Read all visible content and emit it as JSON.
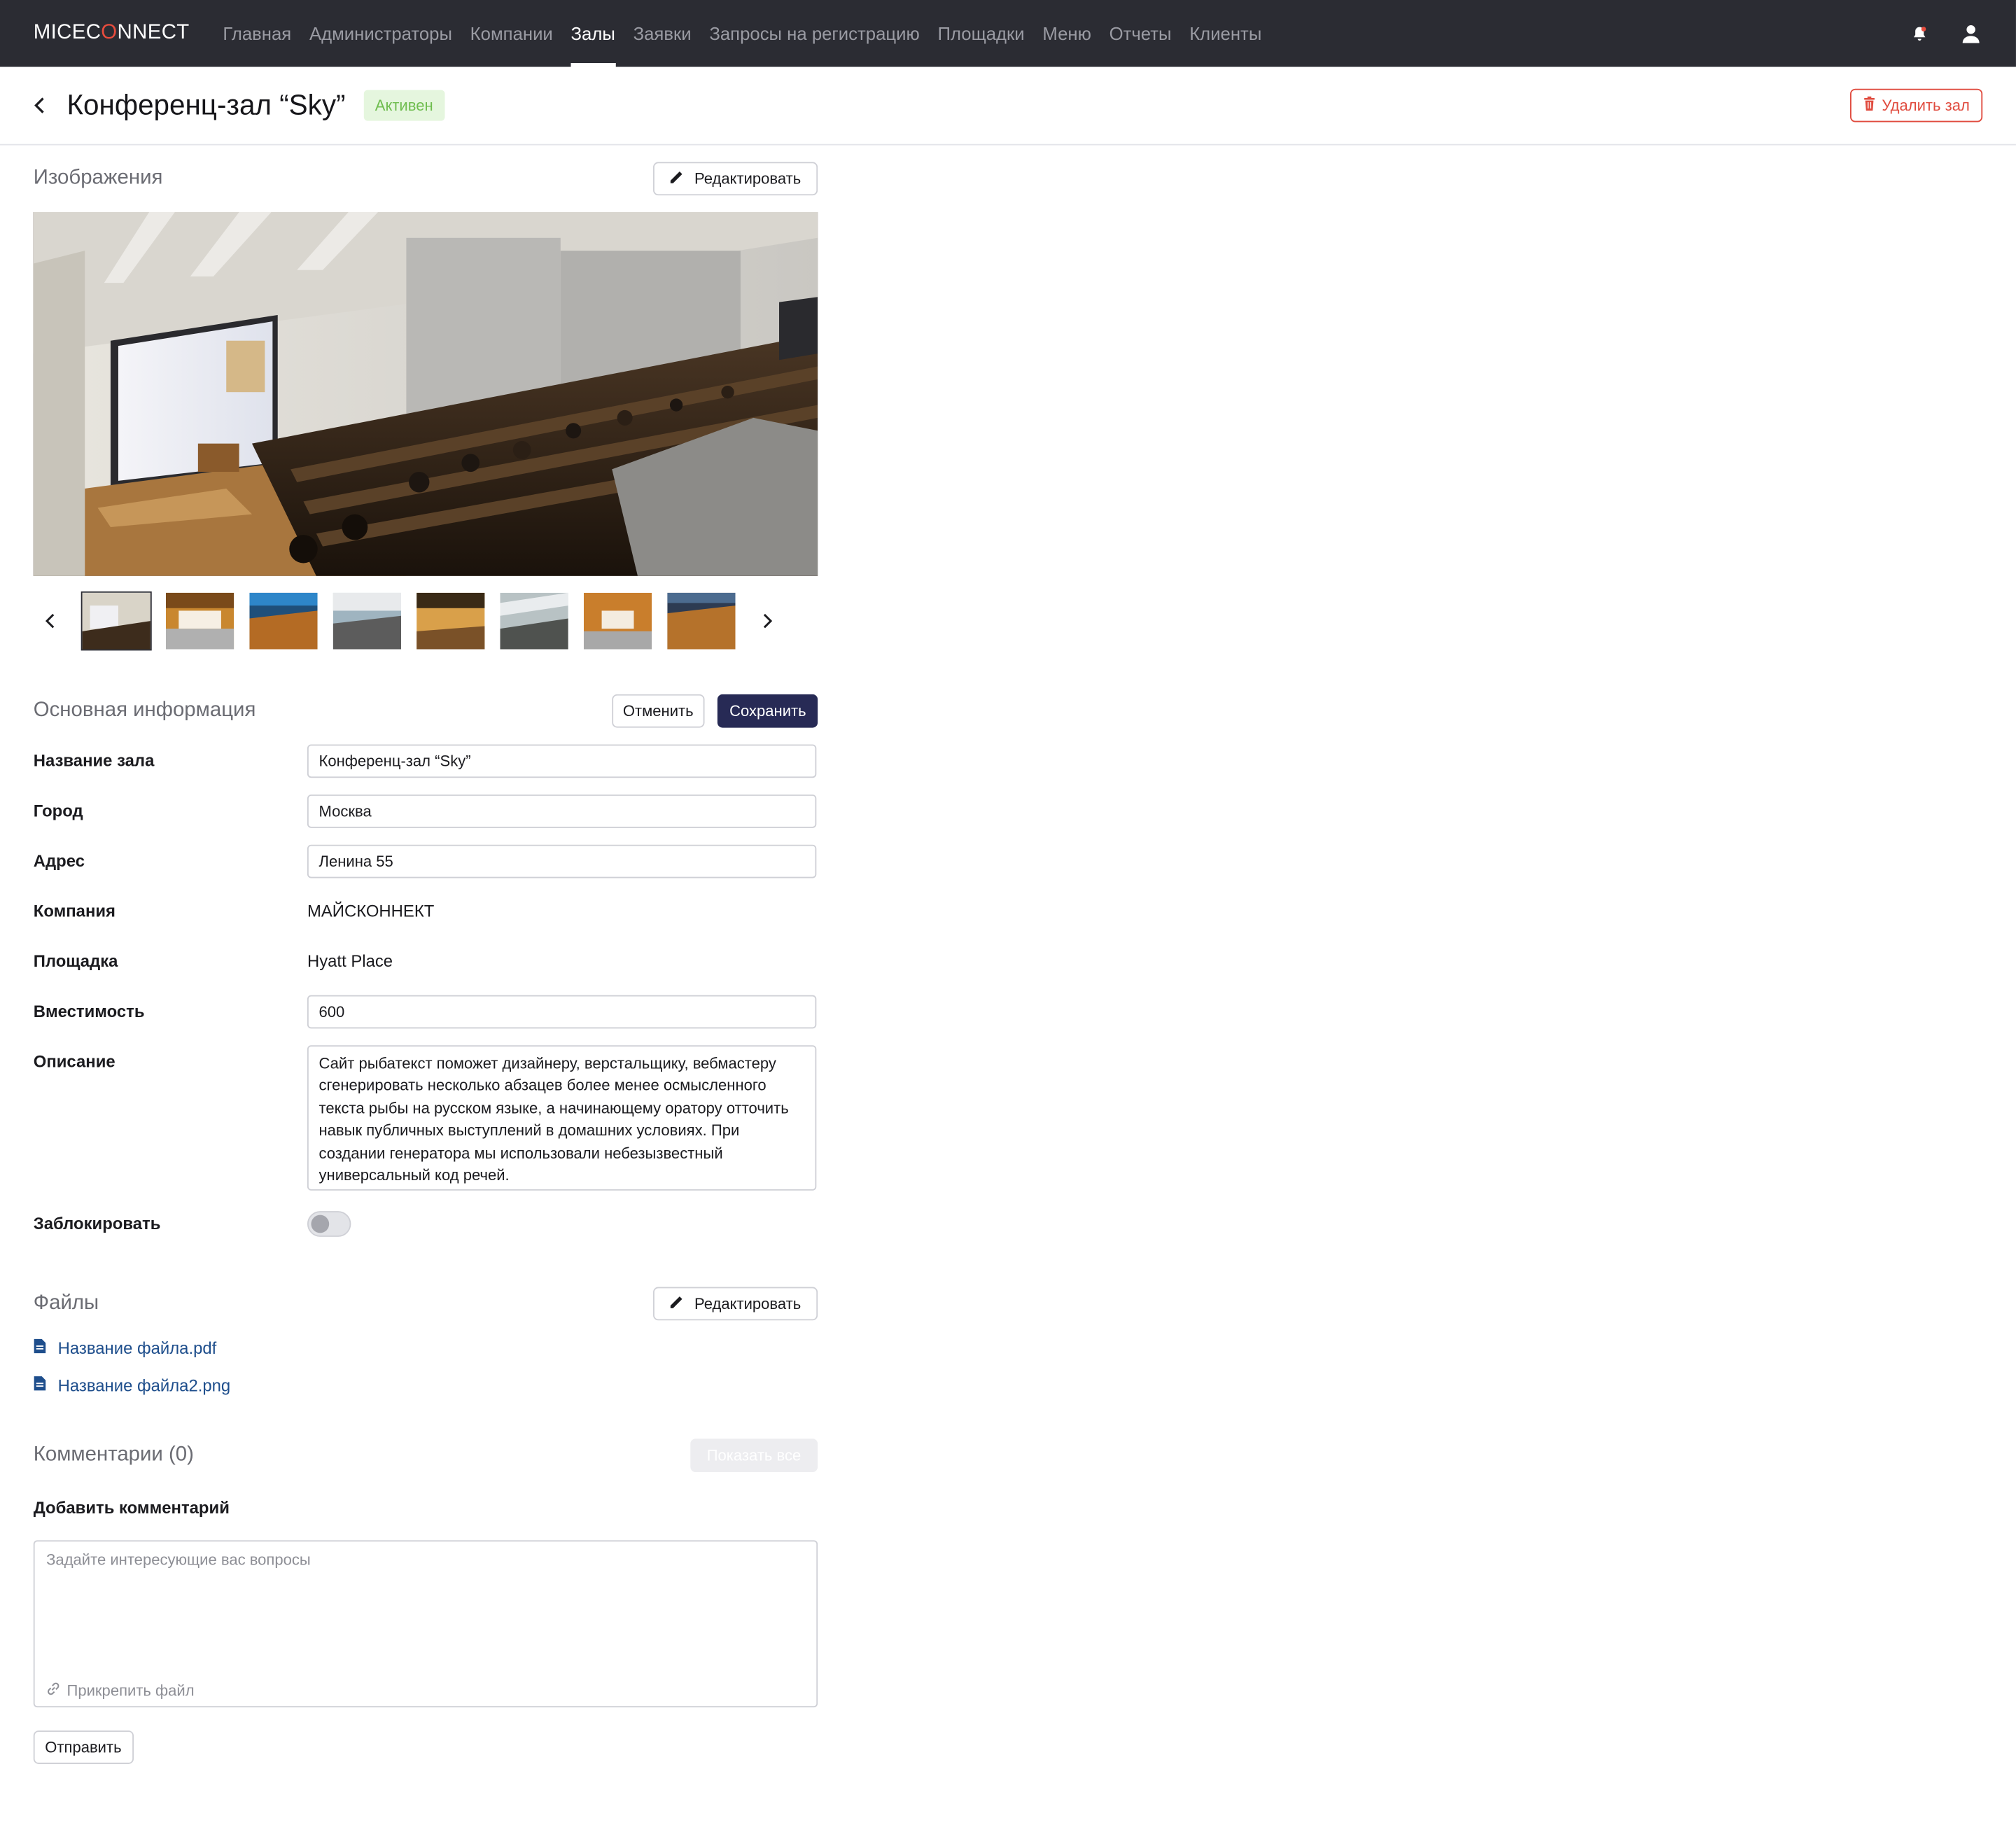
{
  "nav": {
    "logo_pre": "MICEC",
    "logo_o": "O",
    "logo_post": "NNECT",
    "items": [
      "Главная",
      "Администраторы",
      "Компании",
      "Залы",
      "Заявки",
      "Запросы на регистрацию",
      "Площадки",
      "Меню",
      "Отчеты",
      "Клиенты"
    ],
    "active": "Залы"
  },
  "header": {
    "title": "Конференц-зал “Sky”",
    "status": "Активен",
    "delete_label": "Удалить зал"
  },
  "images": {
    "section_title": "Изображения",
    "edit_label": "Редактировать"
  },
  "info": {
    "section_title": "Основная информация",
    "cancel_label": "Отменить",
    "save_label": "Сохранить",
    "fields": {
      "name": {
        "label": "Название зала",
        "value": "Конференц-зал “Sky”"
      },
      "city": {
        "label": "Город",
        "value": "Москва"
      },
      "address": {
        "label": "Адрес",
        "value": "Ленина 55"
      },
      "company": {
        "label": "Компания",
        "value": "МАЙСКОННЕКТ"
      },
      "venue": {
        "label": "Площадка",
        "value": "Hyatt Place"
      },
      "capacity": {
        "label": "Вместимость",
        "value": "600"
      },
      "description": {
        "label": "Описание",
        "value": "Сайт рыбатекст поможет дизайнеру, верстальщику, вебмастеру сгенерировать несколько абзацев более менее осмысленного текста рыбы на русском языке, а начинающему оратору отточить навык публичных выступлений в домашних условиях. При создании генератора мы использовали небезызвестный универсальный код речей."
      },
      "block": {
        "label": "Заблокировать",
        "enabled": false
      }
    }
  },
  "files": {
    "section_title": "Файлы",
    "edit_label": "Редактировать",
    "items": [
      "Название файла.pdf",
      "Название файла2.png"
    ]
  },
  "comments": {
    "section_title": "Комментарии (0)",
    "show_all_label": "Показать все",
    "add_label": "Добавить комментарий",
    "placeholder": "Задайте интересующие вас вопросы",
    "attach_label": "Прикрепить файл",
    "send_label": "Отправить"
  },
  "colors": {
    "nav_bg": "#2b2c33",
    "accent_primary": "#272a55",
    "danger": "#e04b3e",
    "status_bg": "#e5f6de",
    "status_text": "#6fbd4f",
    "link": "#1e4e8c"
  }
}
